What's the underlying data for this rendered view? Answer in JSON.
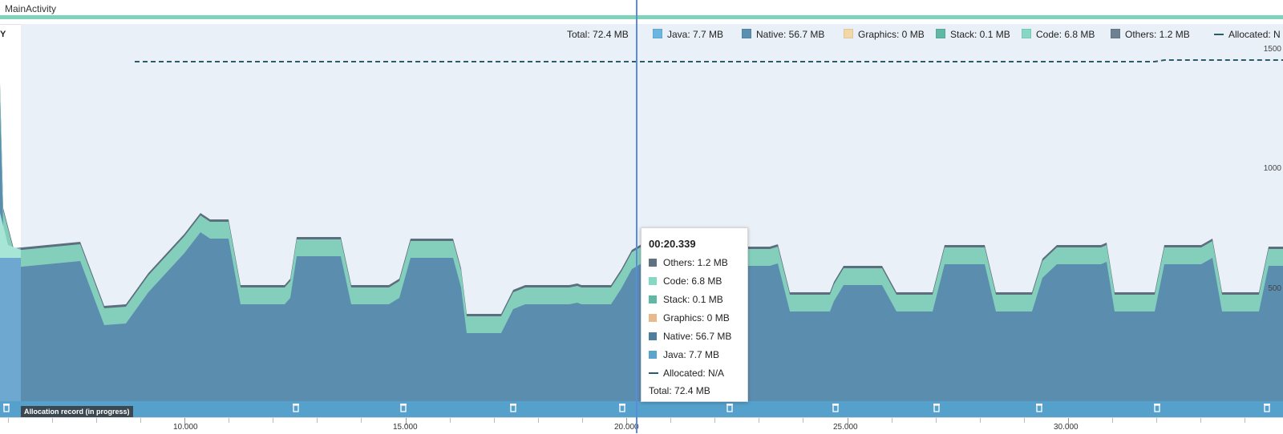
{
  "activity": {
    "label": "MainActivity"
  },
  "y_axis_label": "Y",
  "legend": [
    {
      "key": "total",
      "label": "Total: 72.4 MB",
      "swatch": ""
    },
    {
      "key": "java",
      "label": "Java: 7.7 MB",
      "swatch": "#6bb6e0"
    },
    {
      "key": "native",
      "label": "Native: 56.7 MB",
      "swatch": "#5a8fb0"
    },
    {
      "key": "graphics",
      "label": "Graphics: 0 MB",
      "swatch": "#f2d8a6"
    },
    {
      "key": "stack",
      "label": "Stack: 0.1 MB",
      "swatch": "#5fb8a3"
    },
    {
      "key": "code",
      "label": "Code: 6.8 MB",
      "swatch": "#86d7c4"
    },
    {
      "key": "others",
      "label": "Others: 1.2 MB",
      "swatch": "#6e8191"
    },
    {
      "key": "allocated",
      "label": "Allocated: N",
      "swatch": "dashed"
    }
  ],
  "y_ticks": [
    "1500",
    "1000",
    "500"
  ],
  "alloc_record_label": "Allocation record (in progress)",
  "time_ticks": [
    "10.000",
    "15.000",
    "20.000",
    "25.000",
    "30.000"
  ],
  "tooltip": {
    "time": "00:20.339",
    "rows": [
      {
        "label": "Others: 1.2 MB",
        "color": "#5f7283"
      },
      {
        "label": "Code: 6.8 MB",
        "color": "#86d7c4"
      },
      {
        "label": "Stack: 0.1 MB",
        "color": "#5fb8a3"
      },
      {
        "label": "Graphics: 0 MB",
        "color": "#e8b98a"
      },
      {
        "label": "Native: 56.7 MB",
        "color": "#4e7e9e"
      },
      {
        "label": "Java: 7.7 MB",
        "color": "#5ba4cf"
      },
      {
        "label": "Allocated: N/A",
        "color": "dashed"
      }
    ],
    "total": "Total: 72.4 MB"
  },
  "colors": {
    "plot_bg": "#eaf0f8",
    "java": "#6ea7cf",
    "native": "#5b8daf",
    "code": "#84cfbc",
    "others": "#5d6e7e",
    "allocated_line": "#2c5b6a",
    "cursor": "#5a8bdc"
  },
  "chart_data": {
    "type": "area",
    "title": "",
    "xlabel": "",
    "ylabel": "Y",
    "ylim": [
      0,
      1500
    ],
    "x_ticks": [
      10,
      15,
      20,
      25,
      30
    ],
    "series": [
      {
        "name": "Java",
        "values": []
      },
      {
        "name": "Native",
        "values": []
      },
      {
        "name": "Code",
        "values": []
      },
      {
        "name": "Others",
        "values": []
      },
      {
        "name": "Allocated",
        "values": []
      }
    ],
    "cursor_time": "00:20.339"
  }
}
